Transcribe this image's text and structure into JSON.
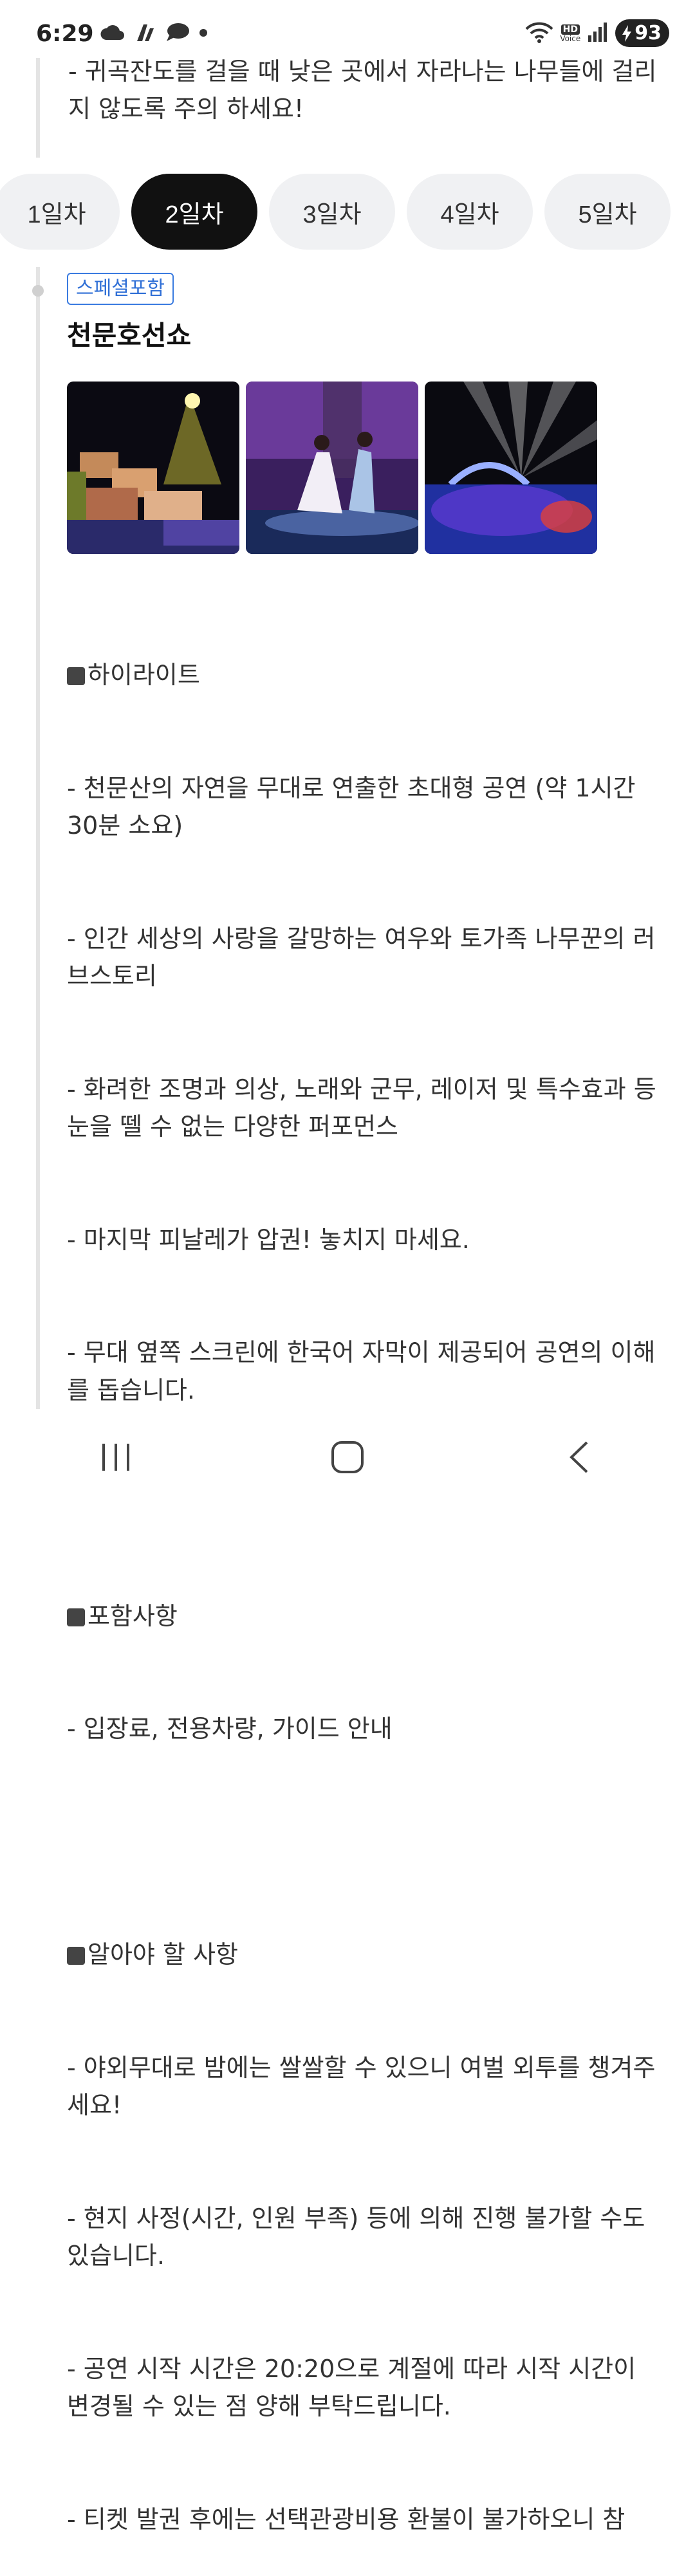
{
  "status_bar": {
    "time": "6:29",
    "hd_label": "HD",
    "voice_label": "Voice",
    "battery": "93"
  },
  "top_note": "- 귀곡잔도를 걸을 때 낮은 곳에서 자라나는 나무들에 걸리지 않도록 주의 하세요!",
  "day_tabs": [
    {
      "label": "1일차",
      "active": false
    },
    {
      "label": "2일차",
      "active": true
    },
    {
      "label": "3일차",
      "active": false
    },
    {
      "label": "4일차",
      "active": false
    },
    {
      "label": "5일차",
      "active": false
    }
  ],
  "item": {
    "badge": "스페셜포함",
    "title": "천문호선쇼",
    "photos": [
      "stage-village-photo",
      "dancers-photo",
      "laser-lights-photo"
    ]
  },
  "highlights": {
    "heading": "하이라이트",
    "lines": [
      "- 천문산의 자연을 무대로 연출한 초대형 공연 (약 1시간 30분 소요)",
      "- 인간 세상의 사랑을 갈망하는 여우와 토가족 나무꾼의 러브스토리",
      "- 화려한 조명과 의상, 노래와 군무, 레이저 및 특수효과 등 눈을 뗄 수 없는 다양한 퍼포먼스",
      "- 마지막 피날레가 압권! 놓치지 마세요.",
      "- 무대 옆쪽 스크린에 한국어 자막이 제공되어 공연의 이해를 돕습니다."
    ]
  },
  "included": {
    "heading": "포함사항",
    "lines": [
      "- 입장료, 전용차량, 가이드 안내"
    ]
  },
  "notes": {
    "heading": "알아야 할 사항",
    "lines": [
      "- 야외무대로 밤에는 쌀쌀할 수 있으니 여벌 외투를 챙겨주세요!",
      "- 현지 사정(시간, 인원 부족) 등에 의해 진행 불가할 수도 있습니다.",
      "- 공연 시작 시간은 20:20으로 계절에 따라 시작 시간이 변경될 수 있는 점 양해 부탁드립니다.",
      "- 티켓 발권 후에는 선택관광비용 환불이 불가하오니 참"
    ]
  },
  "colors": {
    "badge": "#2f6fd6",
    "active_tab": "#111111",
    "tab": "#f0f1f3"
  }
}
